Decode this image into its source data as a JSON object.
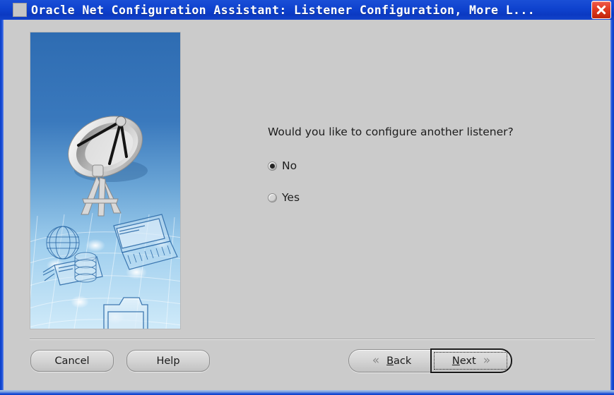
{
  "window": {
    "title": "Oracle Net Configuration Assistant: Listener Configuration, More L...",
    "title_icon": "app-icon",
    "close_icon": "close-x-icon",
    "border_color": "#0b3fc4",
    "titlebar_color": "#0f43cf",
    "close_button_color": "#e13b23",
    "dialog_background": "#cbcbcb"
  },
  "sidebar": {
    "illustration_name": "satellite-dish-network-illustration",
    "sky_color_top": "#2f6fb5",
    "sky_color_bottom": "#bfe0f5"
  },
  "main": {
    "question": "Would you like to configure another listener?",
    "options": [
      {
        "label": "No",
        "selected": true
      },
      {
        "label": "Yes",
        "selected": false
      }
    ]
  },
  "footer": {
    "cancel_label": "Cancel",
    "help_label": "Help",
    "back": {
      "label": "Back",
      "mnemonic": "B",
      "icon": "chevron-left-double-icon",
      "icon_glyph": "«"
    },
    "next": {
      "label": "Next",
      "mnemonic": "N",
      "icon": "chevron-right-double-icon",
      "icon_glyph": "»",
      "focused": true,
      "is_default": true
    }
  }
}
